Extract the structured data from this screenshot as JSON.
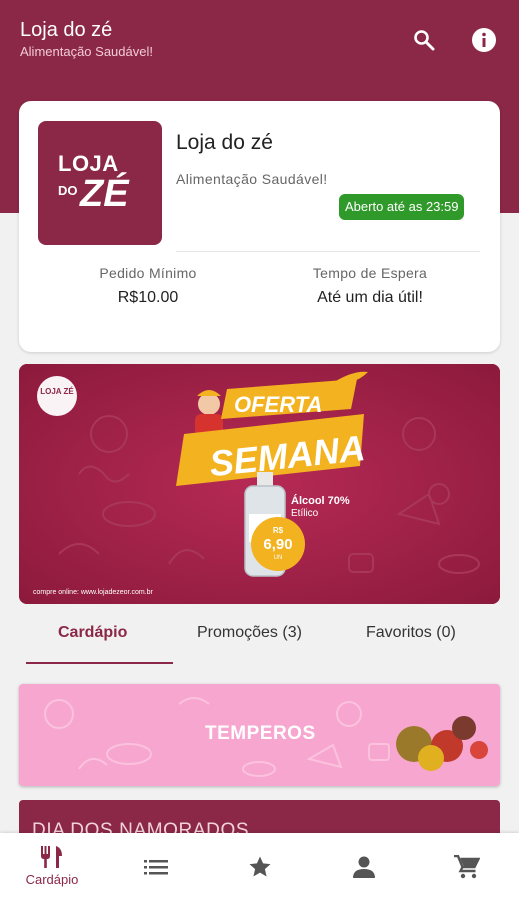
{
  "header": {
    "title": "Loja do zé",
    "subtitle": "Alimentação Saudável!",
    "icons": [
      "search-icon",
      "info-icon"
    ]
  },
  "store": {
    "logo_text_top": "LOJA",
    "logo_text_do": "DO",
    "logo_text_ze": "ZÉ",
    "name": "Loja do zé",
    "tagline": "Alimentação Saudável!",
    "status": "Aberto até as 23:59",
    "min_order_label": "Pedido Mínimo",
    "min_order_value": "R$10.00",
    "wait_label": "Tempo de Espera",
    "wait_value": "Até um dia útil!"
  },
  "banner": {
    "logo_text": "LOJA ZÉ",
    "title_1": "OFERTA",
    "title_2": "SEMANA",
    "product_name": "Álcool 70%",
    "product_sub": "Etílico",
    "price_currency": "R$",
    "price": "6,90",
    "price_unit": "UN",
    "footer": "compre online: www.lojadezeor.com.br"
  },
  "tabs": [
    {
      "label": "Cardápio",
      "active": true
    },
    {
      "label": "Promoções (3)",
      "active": false
    },
    {
      "label": "Favoritos (0)",
      "active": false
    }
  ],
  "categories": [
    {
      "label": "TEMPEROS"
    },
    {
      "label": "DIA DOS NAMORADOS"
    }
  ],
  "bottom_nav": {
    "items": [
      {
        "icon": "restaurant-icon",
        "label": "Cardápio",
        "active": true
      },
      {
        "icon": "list-icon",
        "label": ""
      },
      {
        "icon": "star-icon",
        "label": ""
      },
      {
        "icon": "person-icon",
        "label": ""
      },
      {
        "icon": "cart-icon",
        "label": ""
      }
    ]
  },
  "colors": {
    "brand": "#8b2847",
    "open_badge": "#2f9a2a",
    "category_pink": "#f7a6cf",
    "banner_yellow": "#f3b21f"
  }
}
